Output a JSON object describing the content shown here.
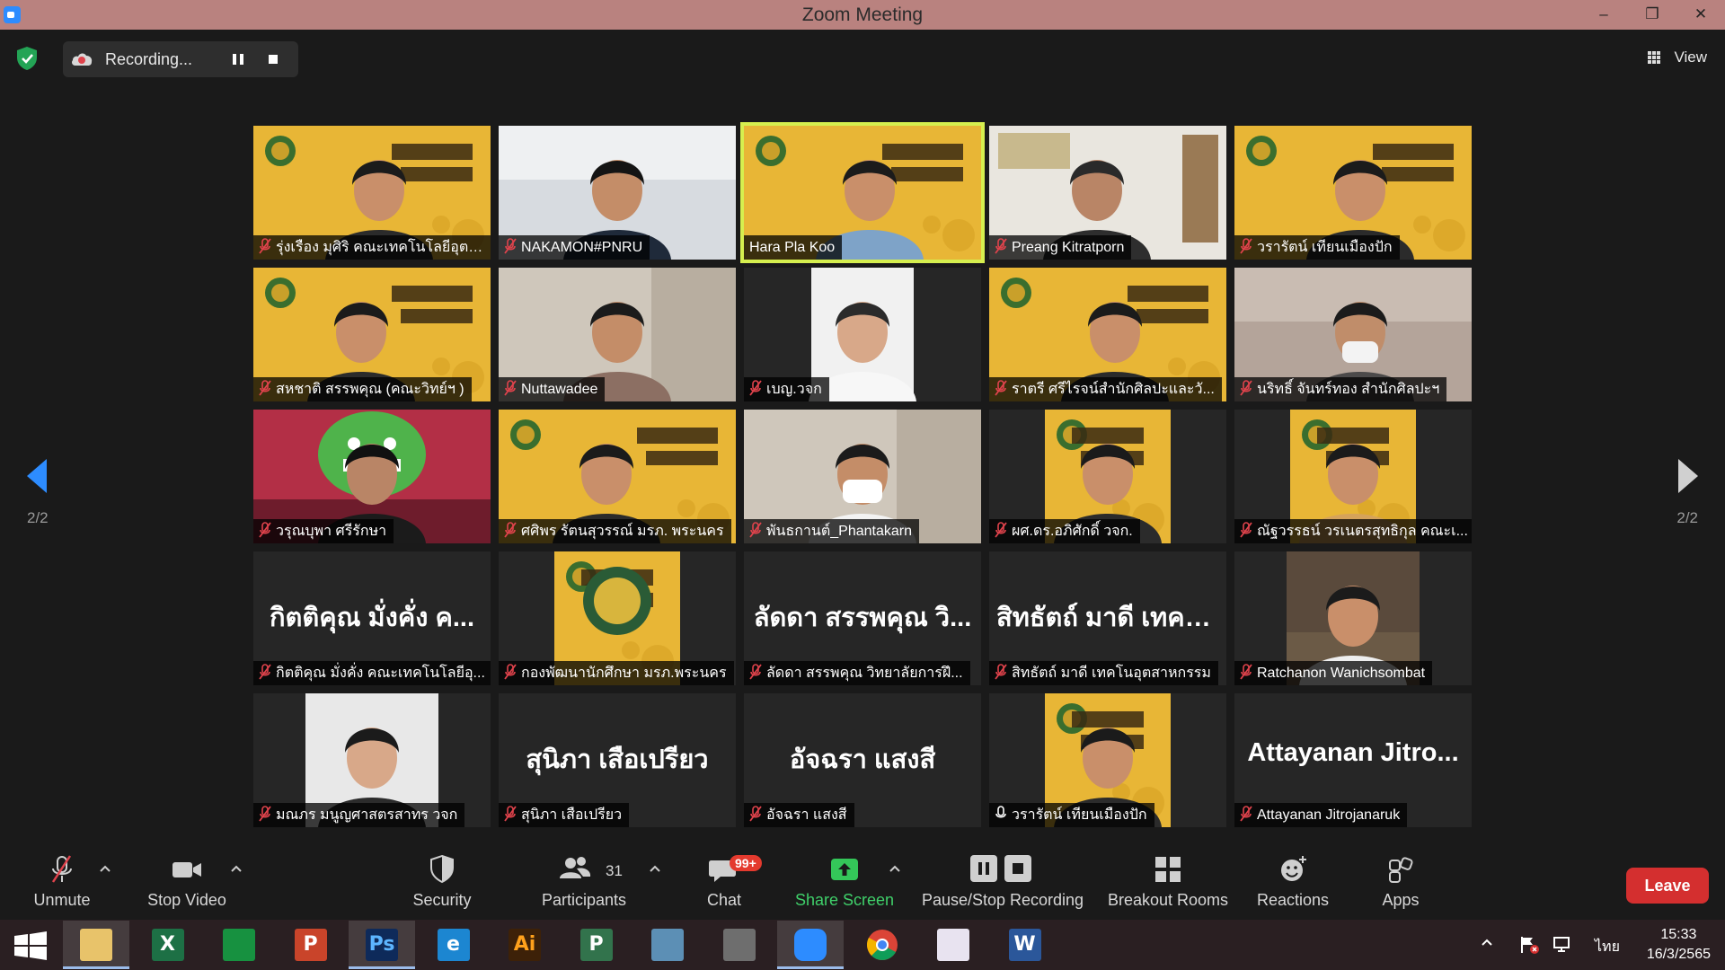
{
  "window": {
    "title": "Zoom Meeting",
    "app_icon": "zoom-icon"
  },
  "recording": {
    "label": "Recording...",
    "view_label": "View"
  },
  "colors": {
    "accent_blue": "#2d8cff",
    "speaker_border": "#d6ef4f",
    "mic_red": "#e0434c",
    "poster_yellow": "#e8b636",
    "leave_red": "#d42f2f",
    "share_green": "#34c759"
  },
  "pagination": {
    "left": "2/2",
    "right": "2/2"
  },
  "tiles": [
    {
      "name": "รุ่งเรือง มุศิริ คณะเทคโนโลยีอุตส...",
      "muted": true,
      "kind": "video",
      "bg": "poster"
    },
    {
      "name": "NAKAMON#PNRU",
      "muted": true,
      "kind": "video",
      "bg": "office"
    },
    {
      "name": "Hara Pla Koo",
      "muted": false,
      "kind": "video",
      "bg": "poster",
      "active": true
    },
    {
      "name": "Preang Kitratporn",
      "muted": true,
      "kind": "video",
      "bg": "room"
    },
    {
      "name": "วรารัตน์ เทียนเมืองปัก",
      "muted": true,
      "kind": "video",
      "bg": "poster"
    },
    {
      "name": "สหชาติ สรรพคุณ (คณะวิทย์ฯ )",
      "muted": true,
      "kind": "video",
      "bg": "poster"
    },
    {
      "name": "Nuttawadee",
      "muted": true,
      "kind": "video",
      "bg": "room2"
    },
    {
      "name": "เบญ.วจก",
      "muted": true,
      "kind": "video",
      "bg": "white"
    },
    {
      "name": "ราตรี   ศรีไรจน์สำนักศิลปะและวั...",
      "muted": true,
      "kind": "video",
      "bg": "poster"
    },
    {
      "name": "นริทธิ์ จันทร์ทอง สำนักศิลปะฯ",
      "muted": true,
      "kind": "video",
      "bg": "blur"
    },
    {
      "name": "วรุณบุพา ศรีรักษา",
      "muted": true,
      "kind": "video",
      "bg": "mask"
    },
    {
      "name": "ศศิพร รัตนสุวรรณ์ มรภ. พระนคร",
      "muted": true,
      "kind": "video",
      "bg": "poster"
    },
    {
      "name": "พันธกานต์_Phantakarn",
      "muted": true,
      "kind": "video",
      "bg": "room2"
    },
    {
      "name": "ผศ.ดร.อภิศักดิ์ วจก.",
      "muted": true,
      "kind": "video",
      "bg": "posterNarrow"
    },
    {
      "name": "ณัฐวรรธน์ วรเนตรสุทธิกุล คณะเ...",
      "muted": true,
      "kind": "video",
      "bg": "posterNarrow"
    },
    {
      "name": "กิตติคุณ  มั่งคั่ง คณะเทคโนโลยีอุ...",
      "muted": true,
      "kind": "name",
      "big": "กิตติคุณ  มั่งคั่ง ค..."
    },
    {
      "name": "กองพัฒนานักศึกษา มรภ.พระนคร",
      "muted": true,
      "kind": "video",
      "bg": "posterNarrow"
    },
    {
      "name": "ลัดดา สรรพคุณ วิทยาลัยการฝึ...",
      "muted": true,
      "kind": "name",
      "big": "ลัดดา สรรพคุณ วิ..."
    },
    {
      "name": "สิทธัตถ์ มาดี เทคโนอุตสาหกรรม",
      "muted": true,
      "kind": "name",
      "big": "สิทธัตถ์ มาดี เทคโ..."
    },
    {
      "name": "Ratchanon Wanichsombat",
      "muted": true,
      "kind": "video",
      "bg": "photoNarrow"
    },
    {
      "name": "มณภร มนูญศาสตรสาทร วจก",
      "muted": true,
      "kind": "video",
      "bg": "whiteNarrow"
    },
    {
      "name": "สุนิภา เสือเปรียว",
      "muted": true,
      "kind": "name",
      "big": "สุนิภา เสือเปรียว"
    },
    {
      "name": "อัจฉรา แสงสี",
      "muted": true,
      "kind": "name",
      "big": "อัจฉรา แสงสี"
    },
    {
      "name": "วรารัตน์ เทียนเมืองปัก",
      "muted": false,
      "kind": "video",
      "bg": "posterNarrow"
    },
    {
      "name": "Attayanan  Jitrojanaruk",
      "muted": true,
      "kind": "name",
      "big": "Attayanan   Jitro..."
    }
  ],
  "toolbar": {
    "unmute": "Unmute",
    "stop_video": "Stop Video",
    "security": "Security",
    "participants": "Participants",
    "participants_count": "31",
    "chat": "Chat",
    "chat_badge": "99+",
    "share_screen": "Share Screen",
    "pause_stop_recording": "Pause/Stop Recording",
    "breakout_rooms": "Breakout Rooms",
    "reactions": "Reactions",
    "apps": "Apps",
    "leave": "Leave"
  },
  "taskbar": {
    "apps": [
      {
        "name": "start-icon"
      },
      {
        "name": "file-explorer-icon"
      },
      {
        "name": "excel-icon",
        "glyph": "X"
      },
      {
        "name": "publisher-store-icon",
        "glyph": ""
      },
      {
        "name": "powerpoint-icon",
        "glyph": "P"
      },
      {
        "name": "photoshop-icon",
        "glyph": "Ps"
      },
      {
        "name": "internet-explorer-icon",
        "glyph": "e"
      },
      {
        "name": "illustrator-icon",
        "glyph": "Ai"
      },
      {
        "name": "project-icon",
        "glyph": "P"
      },
      {
        "name": "notes-icon",
        "glyph": ""
      },
      {
        "name": "photoscape-icon",
        "glyph": ""
      },
      {
        "name": "zoom-app-icon",
        "glyph": ""
      },
      {
        "name": "chrome-icon",
        "glyph": ""
      },
      {
        "name": "paint-icon",
        "glyph": ""
      },
      {
        "name": "word-icon",
        "glyph": "W"
      }
    ],
    "language": "ไทย",
    "time": "15:33",
    "date": "16/3/2565"
  }
}
